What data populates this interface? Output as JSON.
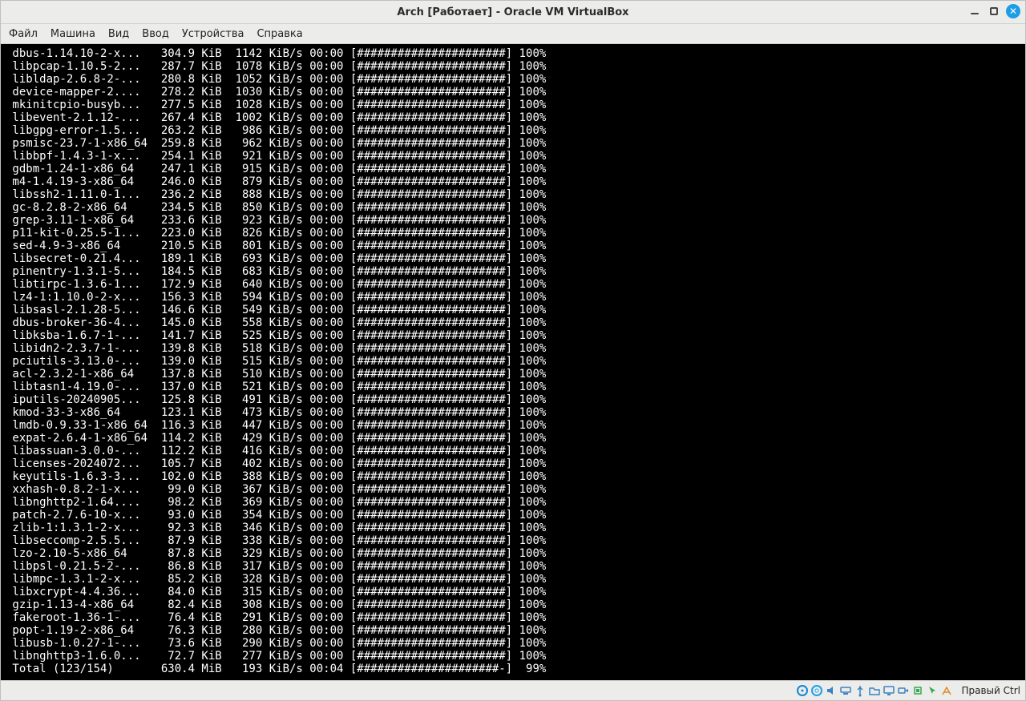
{
  "window": {
    "title": "Arch [Работает] - Oracle VM VirtualBox"
  },
  "menubar": {
    "items": [
      "Файл",
      "Машина",
      "Вид",
      "Ввод",
      "Устройства",
      "Справка"
    ]
  },
  "statusbar": {
    "hostkey": "Правый Ctrl"
  },
  "terminal": {
    "bar_full": "[######################]",
    "bar_99": "[#####################-]",
    "rows": [
      {
        "name": " dbus-1.14.10-2-x...",
        "size": "304.9 KiB",
        "rate": "1142 KiB/s",
        "time": "00:00",
        "pct": "100%",
        "full": true
      },
      {
        "name": " libpcap-1.10.5-2...",
        "size": "287.7 KiB",
        "rate": "1078 KiB/s",
        "time": "00:00",
        "pct": "100%",
        "full": true
      },
      {
        "name": " libldap-2.6.8-2-...",
        "size": "280.8 KiB",
        "rate": "1052 KiB/s",
        "time": "00:00",
        "pct": "100%",
        "full": true
      },
      {
        "name": " device-mapper-2....",
        "size": "278.2 KiB",
        "rate": "1030 KiB/s",
        "time": "00:00",
        "pct": "100%",
        "full": true
      },
      {
        "name": " mkinitcpio-busyb...",
        "size": "277.5 KiB",
        "rate": "1028 KiB/s",
        "time": "00:00",
        "pct": "100%",
        "full": true
      },
      {
        "name": " libevent-2.1.12-...",
        "size": "267.4 KiB",
        "rate": "1002 KiB/s",
        "time": "00:00",
        "pct": "100%",
        "full": true
      },
      {
        "name": " libgpg-error-1.5...",
        "size": "263.2 KiB",
        "rate": " 986 KiB/s",
        "time": "00:00",
        "pct": "100%",
        "full": true
      },
      {
        "name": " psmisc-23.7-1-x86_64",
        "size": "259.8 KiB",
        "rate": " 962 KiB/s",
        "time": "00:00",
        "pct": "100%",
        "full": true
      },
      {
        "name": " libbpf-1.4.3-1-x...",
        "size": "254.1 KiB",
        "rate": " 921 KiB/s",
        "time": "00:00",
        "pct": "100%",
        "full": true
      },
      {
        "name": " gdbm-1.24-1-x86_64  ",
        "size": "247.1 KiB",
        "rate": " 915 KiB/s",
        "time": "00:00",
        "pct": "100%",
        "full": true
      },
      {
        "name": " m4-1.4.19-3-x86_64  ",
        "size": "246.0 KiB",
        "rate": " 879 KiB/s",
        "time": "00:00",
        "pct": "100%",
        "full": true
      },
      {
        "name": " libssh2-1.11.0-1...",
        "size": "236.2 KiB",
        "rate": " 888 KiB/s",
        "time": "00:00",
        "pct": "100%",
        "full": true
      },
      {
        "name": " gc-8.2.8-2-x86_64   ",
        "size": "234.5 KiB",
        "rate": " 850 KiB/s",
        "time": "00:00",
        "pct": "100%",
        "full": true
      },
      {
        "name": " grep-3.11-1-x86_64  ",
        "size": "233.6 KiB",
        "rate": " 923 KiB/s",
        "time": "00:00",
        "pct": "100%",
        "full": true
      },
      {
        "name": " p11-kit-0.25.5-1...",
        "size": "223.0 KiB",
        "rate": " 826 KiB/s",
        "time": "00:00",
        "pct": "100%",
        "full": true
      },
      {
        "name": " sed-4.9-3-x86_64    ",
        "size": "210.5 KiB",
        "rate": " 801 KiB/s",
        "time": "00:00",
        "pct": "100%",
        "full": true
      },
      {
        "name": " libsecret-0.21.4...",
        "size": "189.1 KiB",
        "rate": " 693 KiB/s",
        "time": "00:00",
        "pct": "100%",
        "full": true
      },
      {
        "name": " pinentry-1.3.1-5...",
        "size": "184.5 KiB",
        "rate": " 683 KiB/s",
        "time": "00:00",
        "pct": "100%",
        "full": true
      },
      {
        "name": " libtirpc-1.3.6-1...",
        "size": "172.9 KiB",
        "rate": " 640 KiB/s",
        "time": "00:00",
        "pct": "100%",
        "full": true
      },
      {
        "name": " lz4-1:1.10.0-2-x...",
        "size": "156.3 KiB",
        "rate": " 594 KiB/s",
        "time": "00:00",
        "pct": "100%",
        "full": true
      },
      {
        "name": " libsasl-2.1.28-5...",
        "size": "146.6 KiB",
        "rate": " 549 KiB/s",
        "time": "00:00",
        "pct": "100%",
        "full": true
      },
      {
        "name": " dbus-broker-36-4...",
        "size": "145.0 KiB",
        "rate": " 558 KiB/s",
        "time": "00:00",
        "pct": "100%",
        "full": true
      },
      {
        "name": " libksba-1.6.7-1-...",
        "size": "141.7 KiB",
        "rate": " 525 KiB/s",
        "time": "00:00",
        "pct": "100%",
        "full": true
      },
      {
        "name": " libidn2-2.3.7-1-...",
        "size": "139.8 KiB",
        "rate": " 518 KiB/s",
        "time": "00:00",
        "pct": "100%",
        "full": true
      },
      {
        "name": " pciutils-3.13.0-...",
        "size": "139.0 KiB",
        "rate": " 515 KiB/s",
        "time": "00:00",
        "pct": "100%",
        "full": true
      },
      {
        "name": " acl-2.3.2-1-x86_64  ",
        "size": "137.8 KiB",
        "rate": " 510 KiB/s",
        "time": "00:00",
        "pct": "100%",
        "full": true
      },
      {
        "name": " libtasn1-4.19.0-...",
        "size": "137.0 KiB",
        "rate": " 521 KiB/s",
        "time": "00:00",
        "pct": "100%",
        "full": true
      },
      {
        "name": " iputils-20240905...",
        "size": "125.8 KiB",
        "rate": " 491 KiB/s",
        "time": "00:00",
        "pct": "100%",
        "full": true
      },
      {
        "name": " kmod-33-3-x86_64    ",
        "size": "123.1 KiB",
        "rate": " 473 KiB/s",
        "time": "00:00",
        "pct": "100%",
        "full": true
      },
      {
        "name": " lmdb-0.9.33-1-x86_64",
        "size": "116.3 KiB",
        "rate": " 447 KiB/s",
        "time": "00:00",
        "pct": "100%",
        "full": true
      },
      {
        "name": " expat-2.6.4-1-x86_64",
        "size": "114.2 KiB",
        "rate": " 429 KiB/s",
        "time": "00:00",
        "pct": "100%",
        "full": true
      },
      {
        "name": " libassuan-3.0.0-...",
        "size": "112.2 KiB",
        "rate": " 416 KiB/s",
        "time": "00:00",
        "pct": "100%",
        "full": true
      },
      {
        "name": " licenses-2024072...",
        "size": "105.7 KiB",
        "rate": " 402 KiB/s",
        "time": "00:00",
        "pct": "100%",
        "full": true
      },
      {
        "name": " keyutils-1.6.3-3...",
        "size": "102.0 KiB",
        "rate": " 388 KiB/s",
        "time": "00:00",
        "pct": "100%",
        "full": true
      },
      {
        "name": " xxhash-0.8.2-1-x...",
        "size": " 99.0 KiB",
        "rate": " 367 KiB/s",
        "time": "00:00",
        "pct": "100%",
        "full": true
      },
      {
        "name": " libnghttp2-1.64....",
        "size": " 98.2 KiB",
        "rate": " 369 KiB/s",
        "time": "00:00",
        "pct": "100%",
        "full": true
      },
      {
        "name": " patch-2.7.6-10-x...",
        "size": " 93.0 KiB",
        "rate": " 354 KiB/s",
        "time": "00:00",
        "pct": "100%",
        "full": true
      },
      {
        "name": " zlib-1:1.3.1-2-x...",
        "size": " 92.3 KiB",
        "rate": " 346 KiB/s",
        "time": "00:00",
        "pct": "100%",
        "full": true
      },
      {
        "name": " libseccomp-2.5.5...",
        "size": " 87.9 KiB",
        "rate": " 338 KiB/s",
        "time": "00:00",
        "pct": "100%",
        "full": true
      },
      {
        "name": " lzo-2.10-5-x86_64   ",
        "size": " 87.8 KiB",
        "rate": " 329 KiB/s",
        "time": "00:00",
        "pct": "100%",
        "full": true
      },
      {
        "name": " libpsl-0.21.5-2-...",
        "size": " 86.8 KiB",
        "rate": " 317 KiB/s",
        "time": "00:00",
        "pct": "100%",
        "full": true
      },
      {
        "name": " libmpc-1.3.1-2-x...",
        "size": " 85.2 KiB",
        "rate": " 328 KiB/s",
        "time": "00:00",
        "pct": "100%",
        "full": true
      },
      {
        "name": " libxcrypt-4.4.36...",
        "size": " 84.0 KiB",
        "rate": " 315 KiB/s",
        "time": "00:00",
        "pct": "100%",
        "full": true
      },
      {
        "name": " gzip-1.13-4-x86_64  ",
        "size": " 82.4 KiB",
        "rate": " 308 KiB/s",
        "time": "00:00",
        "pct": "100%",
        "full": true
      },
      {
        "name": " fakeroot-1.36-1-...",
        "size": " 76.4 KiB",
        "rate": " 291 KiB/s",
        "time": "00:00",
        "pct": "100%",
        "full": true
      },
      {
        "name": " popt-1.19-2-x86_64  ",
        "size": " 76.3 KiB",
        "rate": " 280 KiB/s",
        "time": "00:00",
        "pct": "100%",
        "full": true
      },
      {
        "name": " libusb-1.0.27-1-...",
        "size": " 73.6 KiB",
        "rate": " 290 KiB/s",
        "time": "00:00",
        "pct": "100%",
        "full": true
      },
      {
        "name": " libnghttp3-1.6.0...",
        "size": " 72.7 KiB",
        "rate": " 277 KiB/s",
        "time": "00:00",
        "pct": "100%",
        "full": true
      },
      {
        "name": " Total (123/154)     ",
        "size": "630.4 MiB",
        "rate": " 193 KiB/s",
        "time": "00:04",
        "pct": " 99%",
        "full": false
      }
    ]
  }
}
